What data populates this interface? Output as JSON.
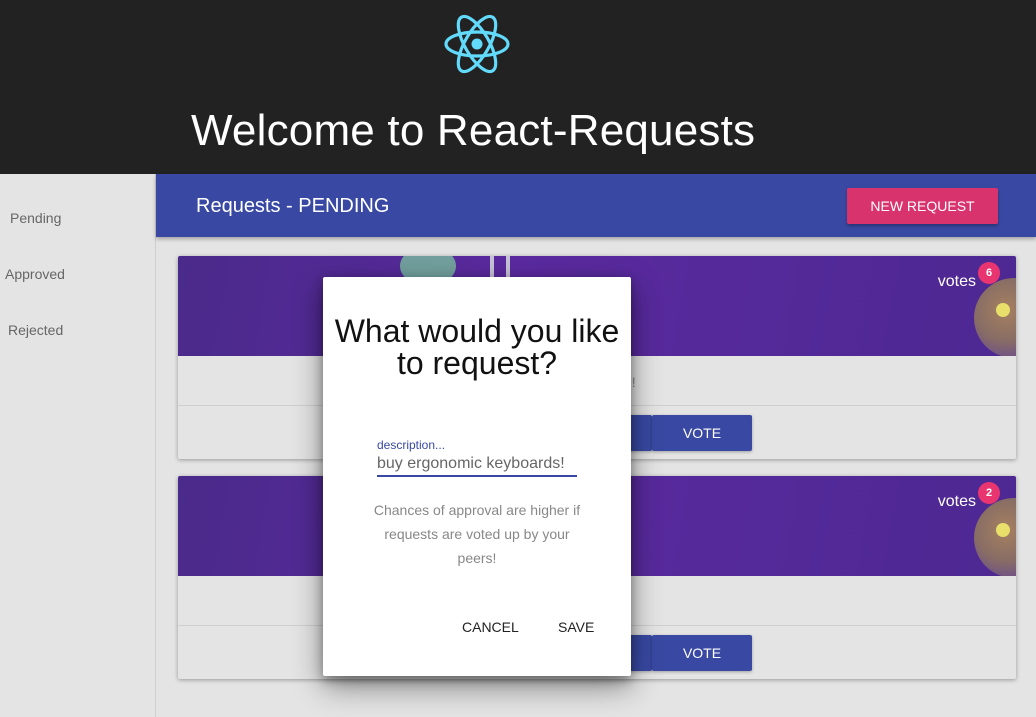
{
  "header": {
    "title": "Welcome to React-Requests",
    "logo_icon": "react-atom-icon",
    "logo_color": "#61dafb"
  },
  "sidebar": {
    "items": [
      {
        "label": "Pending"
      },
      {
        "label": "Approved"
      },
      {
        "label": "Rejected"
      }
    ]
  },
  "appbar": {
    "title": "Requests - PENDING",
    "new_request_label": "NEW REQUEST"
  },
  "cards": [
    {
      "votes_label": "votes",
      "vote_count": "6",
      "text": "e!",
      "vote_label": "VOTE"
    },
    {
      "votes_label": "votes",
      "vote_count": "2",
      "text": "",
      "vote_label": "VOTE"
    }
  ],
  "dialog": {
    "title": "What would you like to request?",
    "field_label": "description...",
    "field_value": "buy ergonomic keyboards!",
    "body": "Chances of approval are higher if requests are voted up by your peers!",
    "cancel_label": "CANCEL",
    "save_label": "SAVE"
  },
  "colors": {
    "primary": "#3949a3",
    "accent": "#d9336e",
    "header_bg": "#222222",
    "card_media": "#5b2aa0"
  }
}
